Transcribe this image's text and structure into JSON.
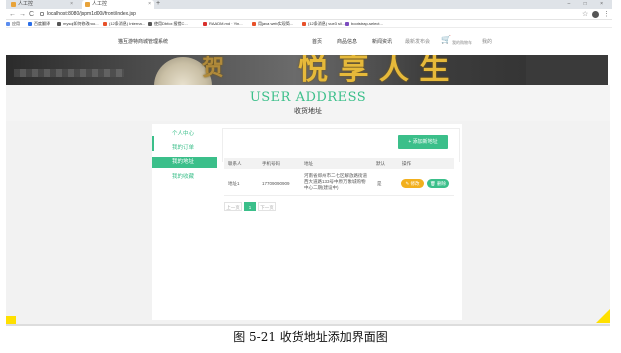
{
  "browser": {
    "tabs": [
      {
        "label": "人工控"
      },
      {
        "label": "人工控"
      }
    ],
    "new_tab": "+",
    "window_controls": "– □ ×",
    "nav": {
      "back": "←",
      "forward": "→",
      "reload": "C"
    },
    "url": "localhost:8080/jspm1d00i/front/index.jsp",
    "bookmarks": [
      {
        "label": "应用",
        "color": "#5b8def"
      },
      {
        "label": "百度翻译",
        "color": "#2a6ee8"
      },
      {
        "label": "mysql如何修改roo...",
        "color": "#555555"
      },
      {
        "label": "(12条消息) Interna...",
        "color": "#e8512a"
      },
      {
        "label": "使用Dbfox 报错C...",
        "color": "#555555"
      },
      {
        "label": "RAADM.md · Yin...",
        "color": "#d9302c"
      },
      {
        "label": "用java web实现简...",
        "color": "#e8512a"
      },
      {
        "label": "(12条消息) vue3 sil...",
        "color": "#e8512a"
      },
      {
        "label": "bootstrap-select...",
        "color": "#7b4bbf"
      }
    ]
  },
  "site": {
    "brand": "猫互游特商城管理系统",
    "nav": [
      {
        "label": "首页"
      },
      {
        "label": "商品信息"
      },
      {
        "label": "新闻资讯"
      },
      {
        "label": "最新发布会"
      },
      {
        "label": "我的购物车"
      },
      {
        "label": "我的"
      }
    ]
  },
  "banner": {
    "calligraphy": "悦 享 人 生",
    "seal": "贺"
  },
  "page": {
    "title_en": "USER ADDRESS",
    "title_cn": "收货地址"
  },
  "sidebar": {
    "items": [
      {
        "label": "个人中心"
      },
      {
        "label": "我的订单"
      },
      {
        "label": "我的地址"
      },
      {
        "label": "我的收藏"
      }
    ]
  },
  "content": {
    "add_button": "+ 添加新地址",
    "columns": [
      "联系人",
      "手机号码",
      "地址",
      "默认",
      "操作"
    ],
    "rows": [
      {
        "contact": "地址1",
        "phone": "17709090909",
        "address": [
          "河南省郑州市二七区解放路街道",
          "西大道路133号中原万象城购物",
          "中心二期(建设中)"
        ],
        "default": "是",
        "edit": "✎ 修改",
        "delete": "🗑 删除"
      }
    ],
    "pagination": {
      "prev": "上一页",
      "current": "1",
      "next": "下一页"
    }
  },
  "caption": "图 5-21 收货地址添加界面图"
}
